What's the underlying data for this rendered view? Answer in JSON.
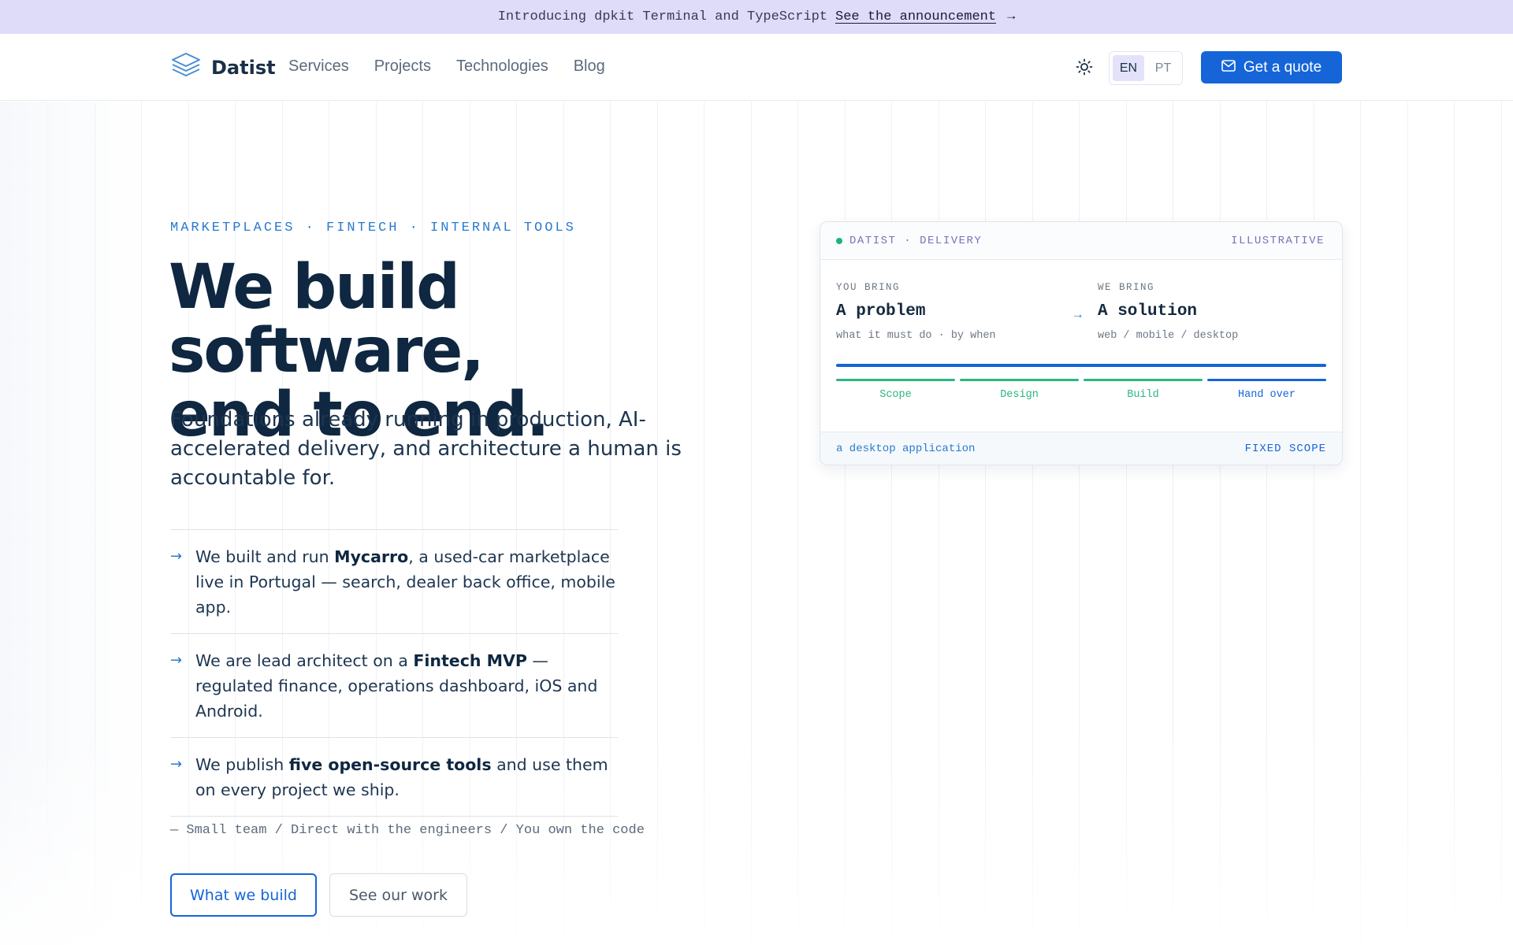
{
  "announcement": {
    "text": "Introducing dpkit Terminal and TypeScript",
    "link": "See the announcement",
    "arrow": "→"
  },
  "header": {
    "brand": "Datist",
    "nav": [
      "Services",
      "Projects",
      "Technologies",
      "Blog"
    ],
    "lang": [
      "EN",
      "PT"
    ],
    "lang_active": "EN",
    "cta": "Get a quote",
    "theme_icon": "sun-icon"
  },
  "hero": {
    "eyebrow": "MARKETPLACES · FINTECH · INTERNAL TOOLS",
    "title_line1": "We build software,",
    "title_line2": "end to end.",
    "subtitle": "Foundations already running in production, AI-accelerated delivery, and architecture a human is accountable for.",
    "bullets": [
      {
        "pre": "We built and run ",
        "bold": "Mycarro",
        "post": ", a used-car marketplace live in Portugal — search, dealer back office, mobile app."
      },
      {
        "pre": "We are lead architect on a ",
        "bold": "Fintech MVP",
        "post": " — regulated finance, operations dashboard, iOS and Android."
      },
      {
        "pre": "We publish ",
        "bold": "five open-source tools",
        "post": " and use them on every project we ship."
      }
    ],
    "tagline": "— Small team / Direct with the engineers / You own the code",
    "btn_primary": "What we build",
    "btn_secondary": "See our work"
  },
  "card": {
    "header_left": "DATIST · DELIVERY",
    "header_right": "ILLUSTRATIVE",
    "you_label": "YOU BRING",
    "you_value": "A problem",
    "you_note": "what it must do · by when",
    "arrow": "→",
    "we_label": "WE BRING",
    "we_value": "A solution",
    "we_note": "web / mobile / desktop",
    "phases": [
      {
        "name": "Scope",
        "color": "#2bb67f"
      },
      {
        "name": "Design",
        "color": "#2bb67f"
      },
      {
        "name": "Build",
        "color": "#2bb67f"
      },
      {
        "name": "Hand over",
        "color": "#1565d8"
      }
    ],
    "footer_left": "a desktop application",
    "footer_right": "FIXED SCOPE"
  },
  "colors": {
    "accent": "#1565d8",
    "announcement_bg": "#dfdcfa",
    "heading": "#0f2740",
    "status_dot": "#1fb37a"
  }
}
